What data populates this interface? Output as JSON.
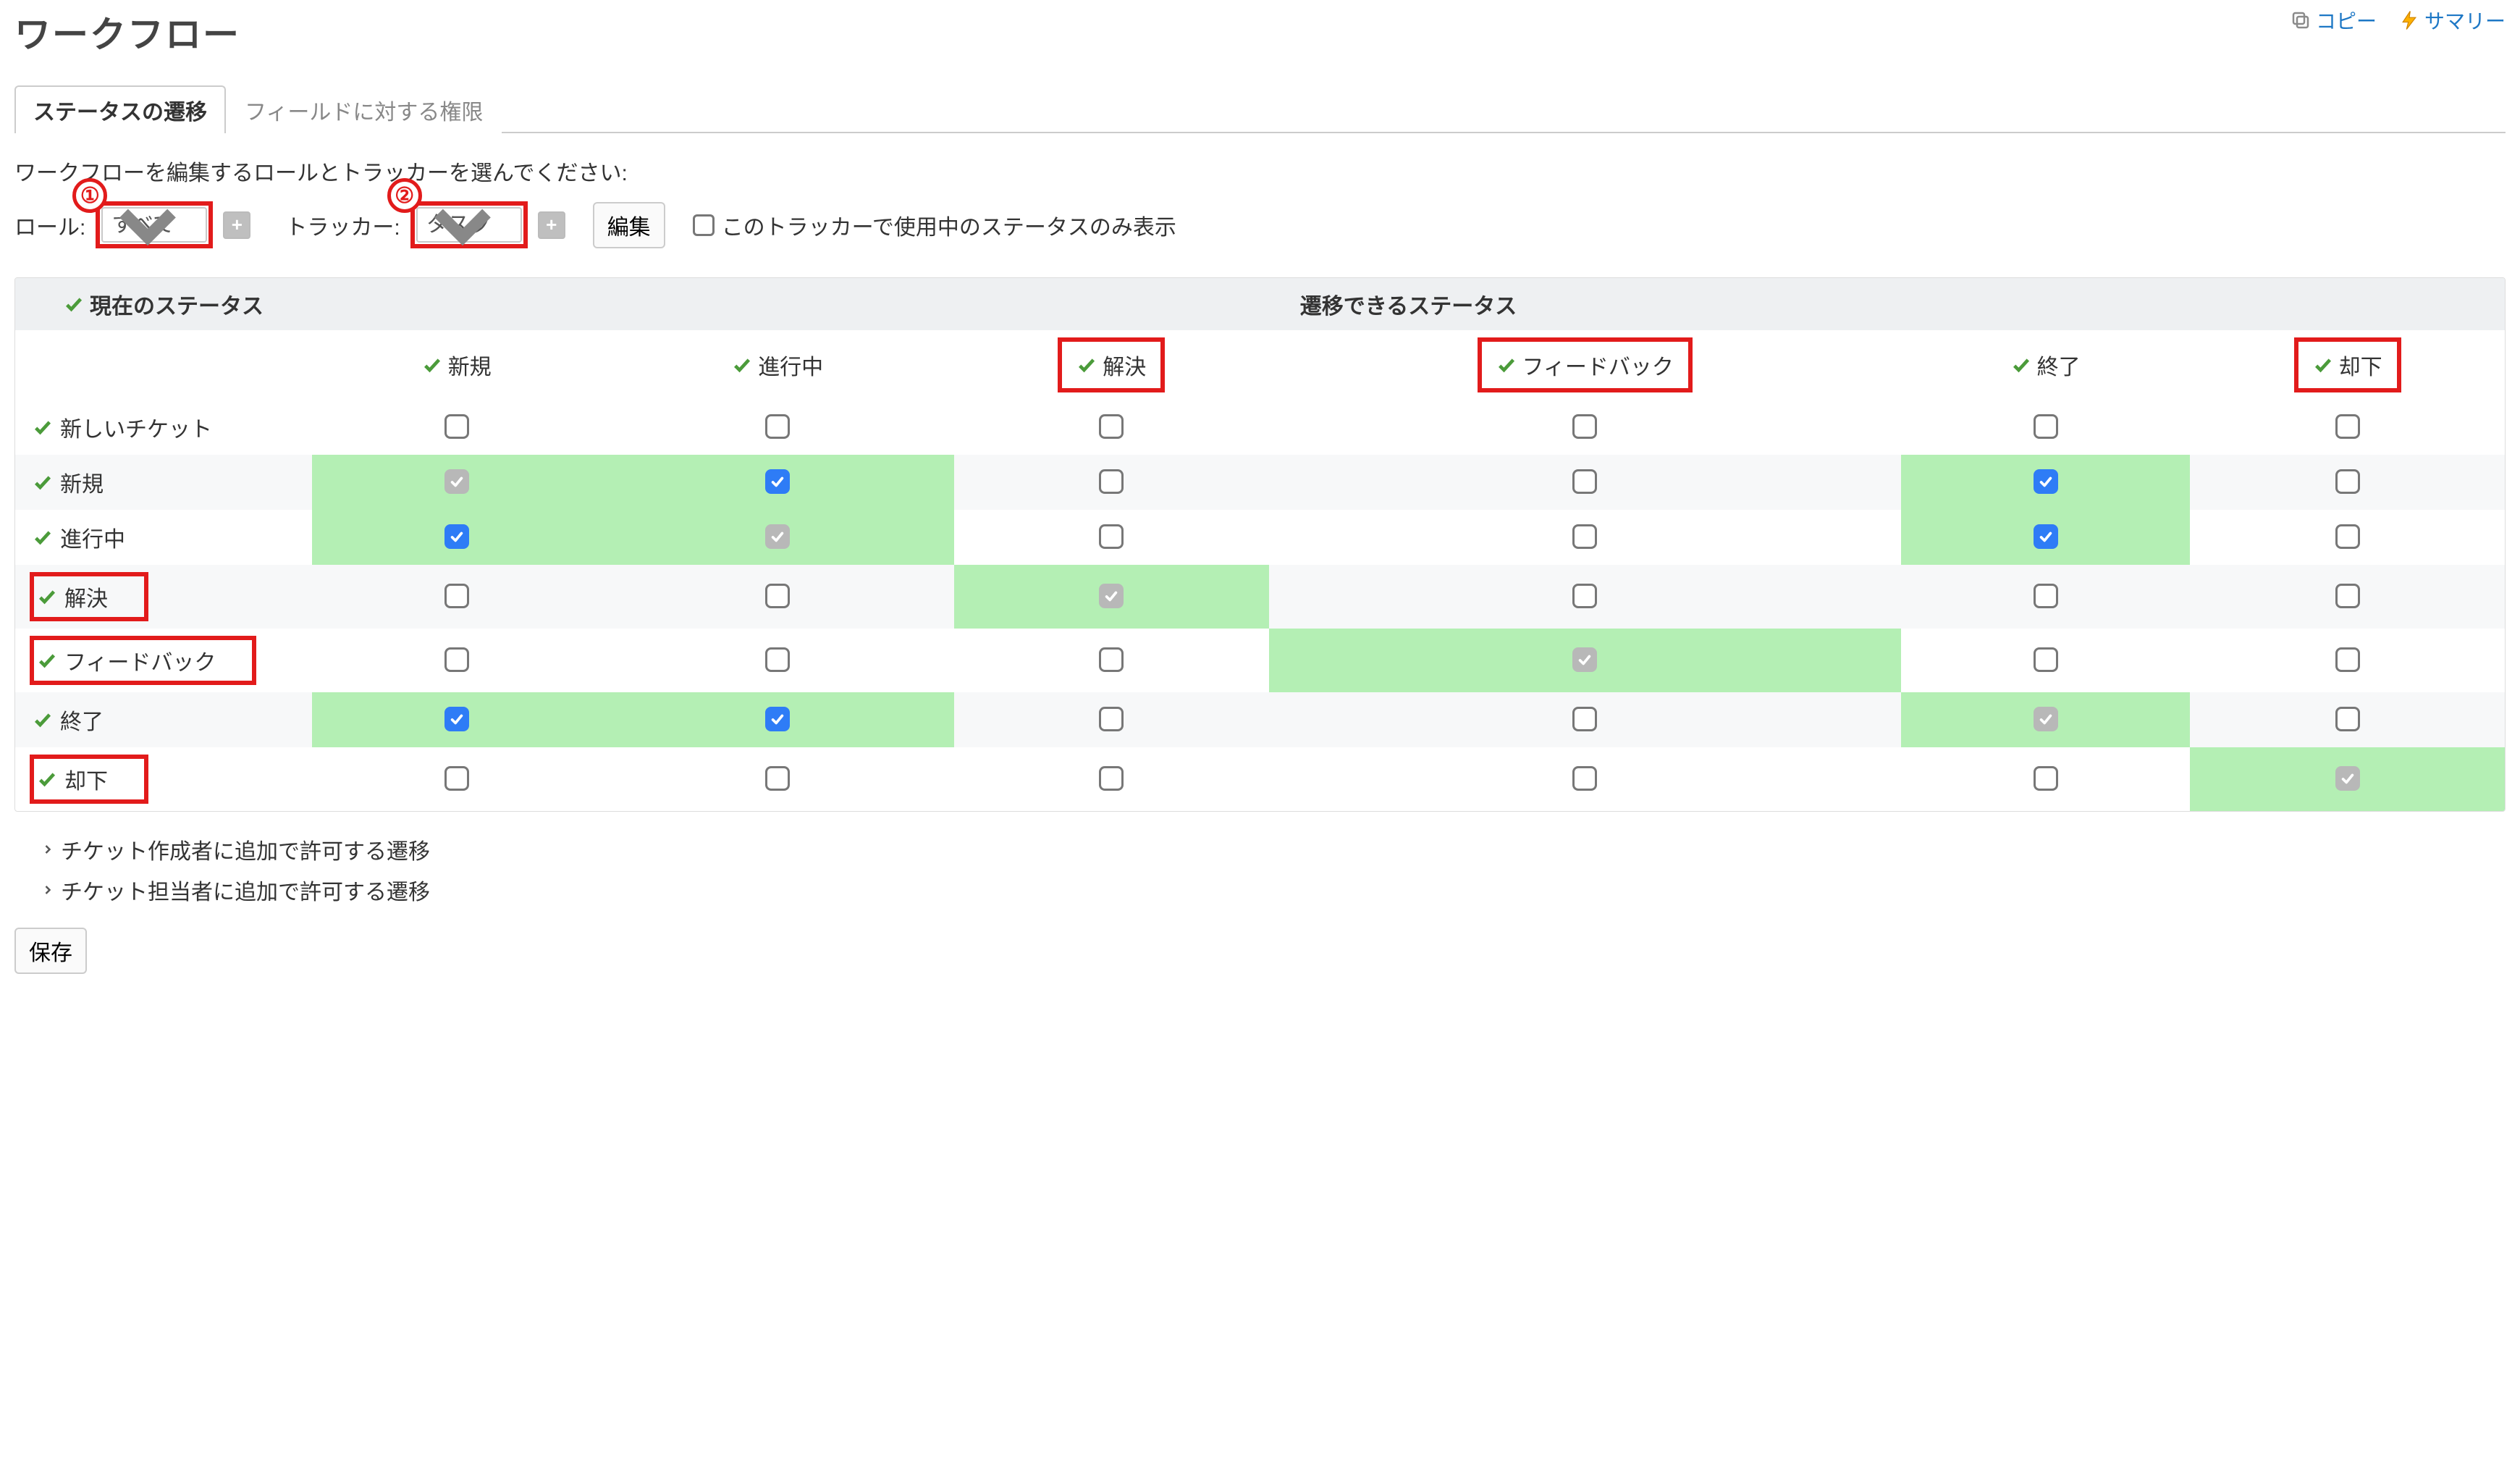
{
  "page_title": "ワークフロー",
  "top_actions": {
    "copy": "コピー",
    "summary": "サマリー"
  },
  "tabs": {
    "active": "ステータスの遷移",
    "other": "フィールドに対する権限"
  },
  "instruction": "ワークフローを編集するロールとトラッカーを選んでください:",
  "filter": {
    "role_label": "ロール:",
    "role_value": "すべて",
    "tracker_label": "トラッカー:",
    "tracker_value": "タスク",
    "edit": "編集",
    "only_used": "このトラッカーで使用中のステータスのみ表示",
    "badge1": "①",
    "badge2": "②"
  },
  "matrix": {
    "group_current": "現在のステータス",
    "group_transition": "遷移できるステータス",
    "columns": [
      {
        "label": "新規",
        "highlight": false
      },
      {
        "label": "進行中",
        "highlight": false
      },
      {
        "label": "解決",
        "highlight": true
      },
      {
        "label": "フィードバック",
        "highlight": true
      },
      {
        "label": "終了",
        "highlight": false
      },
      {
        "label": "却下",
        "highlight": true
      }
    ],
    "rows": [
      {
        "label": "新しいチケット",
        "highlight": false,
        "cells": [
          {
            "s": "off",
            "h": false
          },
          {
            "s": "off",
            "h": false
          },
          {
            "s": "off",
            "h": false
          },
          {
            "s": "off",
            "h": false
          },
          {
            "s": "off",
            "h": false
          },
          {
            "s": "off",
            "h": false
          }
        ]
      },
      {
        "label": "新規",
        "highlight": false,
        "cells": [
          {
            "s": "gray",
            "h": true
          },
          {
            "s": "blue",
            "h": true
          },
          {
            "s": "off",
            "h": false
          },
          {
            "s": "off",
            "h": false
          },
          {
            "s": "blue",
            "h": true
          },
          {
            "s": "off",
            "h": false
          }
        ]
      },
      {
        "label": "進行中",
        "highlight": false,
        "cells": [
          {
            "s": "blue",
            "h": true
          },
          {
            "s": "gray",
            "h": true
          },
          {
            "s": "off",
            "h": false
          },
          {
            "s": "off",
            "h": false
          },
          {
            "s": "blue",
            "h": true
          },
          {
            "s": "off",
            "h": false
          }
        ]
      },
      {
        "label": "解決",
        "highlight": true,
        "cells": [
          {
            "s": "off",
            "h": false
          },
          {
            "s": "off",
            "h": false
          },
          {
            "s": "gray",
            "h": true
          },
          {
            "s": "off",
            "h": false
          },
          {
            "s": "off",
            "h": false
          },
          {
            "s": "off",
            "h": false
          }
        ]
      },
      {
        "label": "フィードバック",
        "highlight": true,
        "cells": [
          {
            "s": "off",
            "h": false
          },
          {
            "s": "off",
            "h": false
          },
          {
            "s": "off",
            "h": false
          },
          {
            "s": "gray",
            "h": true
          },
          {
            "s": "off",
            "h": false
          },
          {
            "s": "off",
            "h": false
          }
        ]
      },
      {
        "label": "終了",
        "highlight": false,
        "cells": [
          {
            "s": "blue",
            "h": true
          },
          {
            "s": "blue",
            "h": true
          },
          {
            "s": "off",
            "h": false
          },
          {
            "s": "off",
            "h": false
          },
          {
            "s": "gray",
            "h": true
          },
          {
            "s": "off",
            "h": false
          }
        ]
      },
      {
        "label": "却下",
        "highlight": true,
        "cells": [
          {
            "s": "off",
            "h": false
          },
          {
            "s": "off",
            "h": false
          },
          {
            "s": "off",
            "h": false
          },
          {
            "s": "off",
            "h": false
          },
          {
            "s": "off",
            "h": false
          },
          {
            "s": "gray",
            "h": true
          }
        ]
      }
    ]
  },
  "extras": {
    "author": "チケット作成者に追加で許可する遷移",
    "assignee": "チケット担当者に追加で許可する遷移"
  },
  "save": "保存"
}
